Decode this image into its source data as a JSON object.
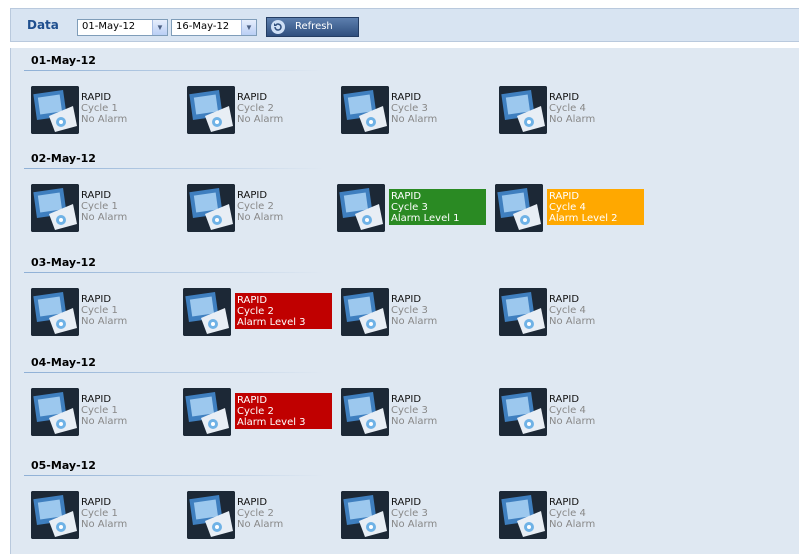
{
  "toolbar": {
    "label": "Data",
    "from_date": "01-May-12",
    "to_date": "16-May-12",
    "refresh_label": "Refresh"
  },
  "colors": {
    "green": "#2a8a23",
    "orange": "#ffa800",
    "red": "#c00000"
  },
  "sections": [
    {
      "date": "01-May-12",
      "items": [
        {
          "name": "RAPID",
          "cycle": "Cycle 1",
          "status": "No Alarm",
          "style": ""
        },
        {
          "name": "RAPID",
          "cycle": "Cycle 2",
          "status": "No Alarm",
          "style": ""
        },
        {
          "name": "RAPID",
          "cycle": "Cycle 3",
          "status": "No Alarm",
          "style": ""
        },
        {
          "name": "RAPID",
          "cycle": "Cycle 4",
          "status": "No Alarm",
          "style": ""
        }
      ]
    },
    {
      "date": "02-May-12",
      "items": [
        {
          "name": "RAPID",
          "cycle": "Cycle 1",
          "status": "No Alarm",
          "style": ""
        },
        {
          "name": "RAPID",
          "cycle": "Cycle 2",
          "status": "No Alarm",
          "style": ""
        },
        {
          "name": "RAPID",
          "cycle": "Cycle 3",
          "status": "Alarm Level 1",
          "style": "green"
        },
        {
          "name": "RAPID",
          "cycle": "Cycle 4",
          "status": "Alarm Level 2",
          "style": "orange"
        }
      ]
    },
    {
      "date": "03-May-12",
      "items": [
        {
          "name": "RAPID",
          "cycle": "Cycle 1",
          "status": "No Alarm",
          "style": ""
        },
        {
          "name": "RAPID",
          "cycle": "Cycle 2",
          "status": "Alarm Level 3",
          "style": "red"
        },
        {
          "name": "RAPID",
          "cycle": "Cycle 3",
          "status": "No Alarm",
          "style": ""
        },
        {
          "name": "RAPID",
          "cycle": "Cycle 4",
          "status": "No Alarm",
          "style": ""
        }
      ]
    },
    {
      "date": "04-May-12",
      "items": [
        {
          "name": "RAPID",
          "cycle": "Cycle 1",
          "status": "No Alarm",
          "style": ""
        },
        {
          "name": "RAPID",
          "cycle": "Cycle 2",
          "status": "Alarm Level 3",
          "style": "red"
        },
        {
          "name": "RAPID",
          "cycle": "Cycle 3",
          "status": "No Alarm",
          "style": ""
        },
        {
          "name": "RAPID",
          "cycle": "Cycle 4",
          "status": "No Alarm",
          "style": ""
        }
      ]
    },
    {
      "date": "05-May-12",
      "items": [
        {
          "name": "RAPID",
          "cycle": "Cycle 1",
          "status": "No Alarm",
          "style": ""
        },
        {
          "name": "RAPID",
          "cycle": "Cycle 2",
          "status": "No Alarm",
          "style": ""
        },
        {
          "name": "RAPID",
          "cycle": "Cycle 3",
          "status": "No Alarm",
          "style": ""
        },
        {
          "name": "RAPID",
          "cycle": "Cycle 4",
          "status": "No Alarm",
          "style": ""
        }
      ]
    }
  ]
}
